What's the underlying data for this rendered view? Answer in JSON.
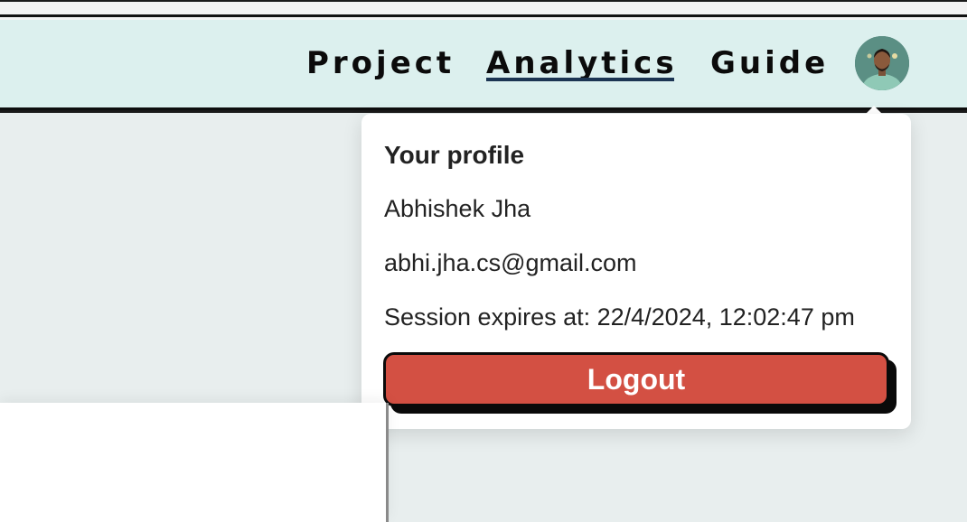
{
  "nav": {
    "links": [
      {
        "label": "Project",
        "active": false
      },
      {
        "label": "Analytics",
        "active": true
      },
      {
        "label": "Guide",
        "active": false
      }
    ],
    "avatar_icon": "user-avatar"
  },
  "profile_menu": {
    "title": "Your profile",
    "name": "Abhishek Jha",
    "email": "abhi.jha.cs@gmail.com",
    "session": "Session expires at: 22/4/2024, 12:02:47 pm",
    "logout_label": "Logout"
  },
  "colors": {
    "nav_background": "#dcf0ee",
    "page_background": "#e8eeee",
    "active_underline": "#1c3553",
    "logout_button": "#d35043"
  }
}
